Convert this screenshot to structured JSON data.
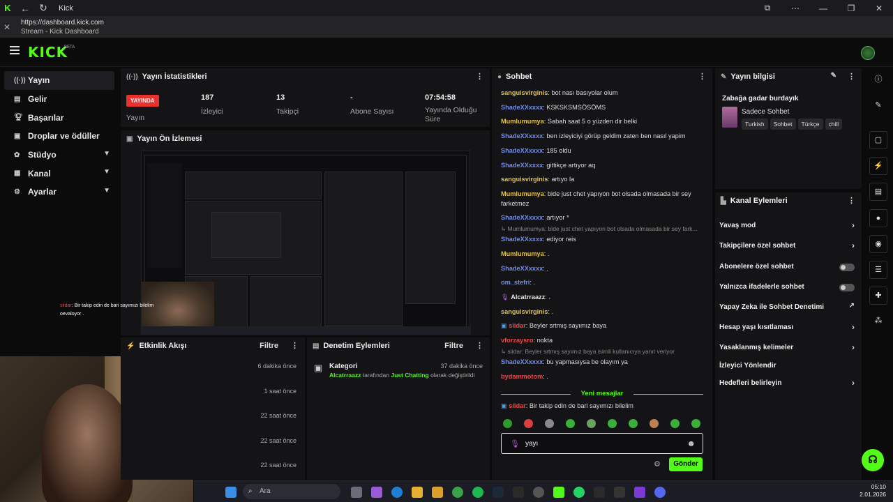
{
  "window": {
    "title": "Kick"
  },
  "urlbar": {
    "url": "https://dashboard.kick.com",
    "page_title": "Stream - Kick Dashboard"
  },
  "header": {
    "logo": "KICK",
    "logo_tag": "BETA"
  },
  "sidebar": {
    "items": [
      {
        "label": "Yayın",
        "icon": "broadcast-icon",
        "active": true
      },
      {
        "label": "Gelir",
        "icon": "revenue-icon"
      },
      {
        "label": "Başarılar",
        "icon": "trophy-icon"
      },
      {
        "label": "Droplar ve ödüller",
        "icon": "gift-icon"
      },
      {
        "label": "Stüdyo",
        "icon": "studio-icon",
        "expandable": true
      },
      {
        "label": "Kanal",
        "icon": "channel-icon",
        "expandable": true
      },
      {
        "label": "Ayarlar",
        "icon": "gear-icon",
        "expandable": true
      }
    ]
  },
  "stats": {
    "title": "Yayın İstatistikleri",
    "live_badge": "YAYINDA",
    "live_label": "Yayın",
    "viewers": "187",
    "viewers_label": "İzleyici",
    "followers": "13",
    "followers_label": "Takipçi",
    "subs": "-",
    "subs_label": "Abone Sayısı",
    "uptime": "07:54:58",
    "uptime_label_1": "Yayında Olduğu",
    "uptime_label_2": "Süre"
  },
  "preview": {
    "title": "Yayın Ön İzlemesi"
  },
  "overlay": {
    "user": "siidar",
    "text": "Bir takip edin de bari sayımızı bilelim",
    "line2": "oevaloyor ."
  },
  "activity": {
    "title": "Etkinlik Akışı",
    "filter": "Filtre",
    "rows": [
      "6 dakika önce",
      "1 saat önce",
      "22 saat önce",
      "22 saat önce",
      "22 saat önce"
    ]
  },
  "moderation": {
    "title": "Denetim Eylemleri",
    "filter": "Filtre",
    "entry_title": "Kategori",
    "entry_time": "37 dakika önce",
    "entry_user": "Alcatrraazz",
    "entry_mid": "tarafından",
    "entry_cat": "Just Chatting",
    "entry_tail": "olarak değiştirildi"
  },
  "chat": {
    "title": "Sohbet",
    "messages": [
      {
        "user": "sanguisvirginis",
        "color": "#e0c04a",
        "text": "bot nası basıyolar olum"
      },
      {
        "user": "ShadeXXxxxx",
        "color": "#6f8df0",
        "text": "KSKSKSMSÖSÖMS"
      },
      {
        "user": "Mumlumumya",
        "color": "#e0c04a",
        "text": "Sabah saat 5 o yüzden dir belki"
      },
      {
        "user": "ShadeXXxxxx",
        "color": "#6f8df0",
        "text": "ben izleyiciyi görüp geldim zaten ben nasıl yapim"
      },
      {
        "user": "ShadeXXxxxx",
        "color": "#6f8df0",
        "text": "185 oldu"
      },
      {
        "user": "ShadeXXxxxx",
        "color": "#6f8df0",
        "text": "gittikçe artıyor aq"
      },
      {
        "user": "sanguisvirginis",
        "color": "#e0c04a",
        "text": "artıyo la"
      },
      {
        "user": "Mumlumumya",
        "color": "#e0c04a",
        "text": "bide just chet yapıyon bot olsada olmasada bir sey farketmez"
      },
      {
        "user": "ShadeXXxxxx",
        "color": "#6f8df0",
        "text": "artıyor *"
      },
      {
        "user": "ShadeXXxxxx",
        "color": "#6f8df0",
        "text": "ediyor reis"
      },
      {
        "user": "Mumlumumya",
        "color": "#e0c04a",
        "text": "."
      },
      {
        "user": "ShadeXXxxxx",
        "color": "#6f8df0",
        "text": "."
      },
      {
        "user": "om_stefri",
        "color": "#6f8df0",
        "text": "."
      },
      {
        "user": "Alcatrraazz",
        "color": "#e8e8e8",
        "text": "."
      },
      {
        "user": "sanguisvirginis",
        "color": "#e0c04a",
        "text": "."
      },
      {
        "user": "siidar",
        "color": "#e34b4b",
        "text": "Beyler srtmış sayımız baya"
      },
      {
        "user": "vforzaysro",
        "color": "#e34b4b",
        "text": "nokta"
      },
      {
        "user": "ShadeXXxxxx",
        "color": "#6f8df0",
        "text": "bu yapmasıysa be olayım ya"
      },
      {
        "user": "bydammotom",
        "color": "#e34b4b",
        "text": "."
      },
      {
        "user": "siidar",
        "color": "#e34b4b",
        "text": "Bir takip edin de bari sayımızı bilelim"
      }
    ],
    "reply1": "Mumlumumya: bide just chet yapıyon bot olsada olmasada bir sey fark...",
    "reply2": "siidar: Beyler srtmış sayımız baya isimli kullanıcıya yanıt veriyor",
    "new_messages": "Yeni mesajlar",
    "input_value": "yayı",
    "send": "Gönder"
  },
  "info": {
    "title": "Yayın bilgisi",
    "stream_title": "Zabağa gadar burdayık",
    "category": "Sadece Sohbet",
    "tags": [
      "Turkish",
      "Sohbet",
      "Türkçe",
      "chill"
    ]
  },
  "actions": {
    "title": "Kanal Eylemleri",
    "items": [
      {
        "label": "Yavaş mod",
        "kind": "chevron"
      },
      {
        "label": "Takipçilere özel sohbet",
        "kind": "chevron"
      },
      {
        "label": "Abonelere özel sohbet",
        "kind": "toggle"
      },
      {
        "label": "Yalnızca ifadelerle sohbet",
        "kind": "toggle"
      },
      {
        "label": "Yapay Zeka ile Sohbet Denetimi",
        "kind": "external"
      },
      {
        "label": "Hesap yaşı kısıtlaması",
        "kind": "chevron"
      },
      {
        "label": "Yasaklanmış kelimeler",
        "kind": "chevron"
      },
      {
        "label": "İzleyici Yönlendir",
        "kind": "none"
      },
      {
        "label": "Hedefleri belirleyin",
        "kind": "chevron"
      }
    ]
  },
  "taskbar": {
    "search_placeholder": "Ara",
    "time": "05:10",
    "date": "2.01.2026"
  }
}
